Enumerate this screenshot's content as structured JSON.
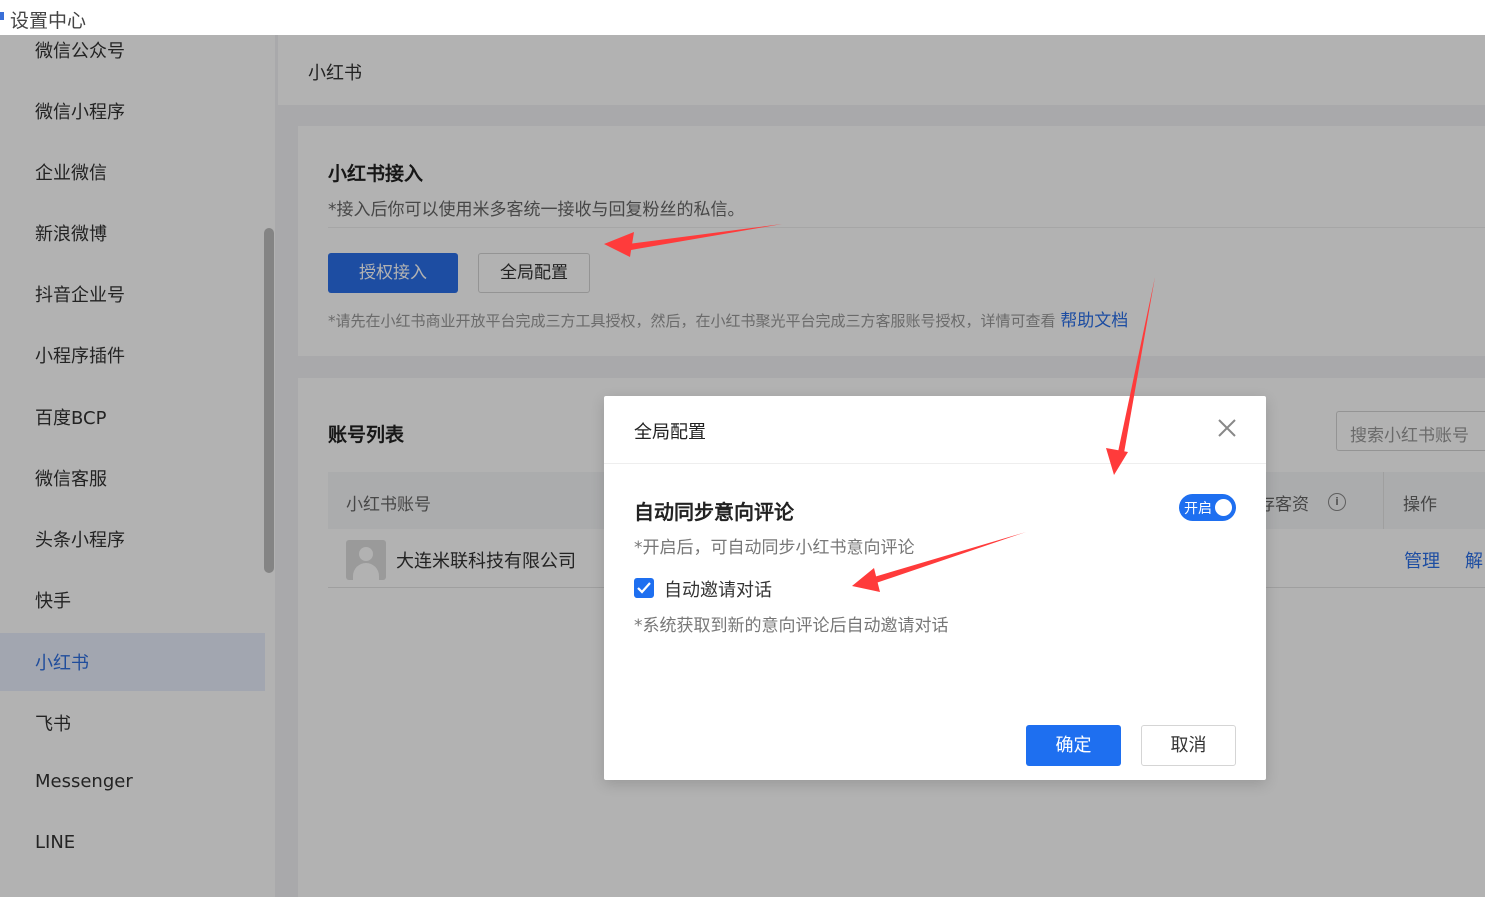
{
  "window": {
    "title": "设置中心"
  },
  "sidebar": {
    "items": [
      {
        "label": "微信公众号"
      },
      {
        "label": "微信小程序"
      },
      {
        "label": "企业微信"
      },
      {
        "label": "新浪微博"
      },
      {
        "label": "抖音企业号"
      },
      {
        "label": "小程序插件"
      },
      {
        "label": "百度BCP"
      },
      {
        "label": "微信客服"
      },
      {
        "label": "头条小程序"
      },
      {
        "label": "快手"
      },
      {
        "label": "小红书",
        "active": true
      },
      {
        "label": "飞书"
      },
      {
        "label": "Messenger"
      },
      {
        "label": "LINE"
      }
    ]
  },
  "header": {
    "title": "小红书"
  },
  "connect": {
    "title": "小红书接入",
    "desc": "*接入后你可以使用米多客统一接收与回复粉丝的私信。",
    "authorize_label": "授权接入",
    "global_config_label": "全局配置",
    "note": "*请先在小红书商业开放平台完成三方工具授权，然后，在小红书聚光平台完成三方客服账号授权，详情可查看",
    "help_link": "帮助文档"
  },
  "accounts": {
    "title": "账号列表",
    "search_placeholder": "搜索小红书账号",
    "columns": {
      "account": "小红书账号",
      "partial_col": "存客资",
      "ops": "操作"
    },
    "rows": [
      {
        "name": "大连米联科技有限公司",
        "manage": "管理",
        "partial_action": "解"
      }
    ]
  },
  "modal": {
    "title": "全局配置",
    "setting_title": "自动同步意向评论",
    "toggle_label": "开启",
    "toggle_on": true,
    "hint1": "*开启后，可自动同步小红书意向评论",
    "checkbox_label": "自动邀请对话",
    "checkbox_checked": true,
    "hint2": "*系统获取到新的意向评论后自动邀请对话",
    "ok_label": "确定",
    "cancel_label": "取消"
  },
  "colors": {
    "accent": "#1e6ff0",
    "annotation_arrow": "#ff3b3b"
  }
}
